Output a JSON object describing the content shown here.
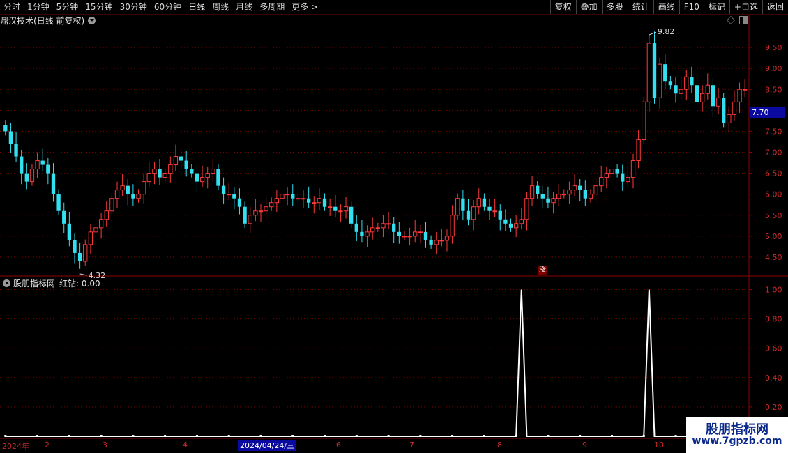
{
  "toolbar": {
    "periods": [
      "分时",
      "1分钟",
      "5分钟",
      "15分钟",
      "30分钟",
      "60分钟",
      "日线",
      "周线",
      "月线",
      "多周期",
      "更多 >"
    ],
    "active_period": "日线",
    "buttons": [
      "复权",
      "叠加",
      "多股",
      "统计",
      "画线",
      "F10",
      "标记",
      "+自选",
      "返回"
    ]
  },
  "price_panel": {
    "title": "鼎汉技术(日线 前复权)",
    "high_marker": "9.82",
    "low_marker": "4.32",
    "current_price": "7.70",
    "limit_up_marker": "涨"
  },
  "indicator_panel": {
    "title": "股朋指标网",
    "value_label": "红钻: 0.00"
  },
  "date_axis": {
    "labels": [
      "2024年",
      "2",
      "3",
      "4",
      "2024/04/24/三",
      "6",
      "7",
      "8",
      "9",
      "10"
    ]
  },
  "watermark": {
    "title": "股朋指标网",
    "url": "www.7gpzb.com"
  },
  "colors": {
    "up": "#ff3a3a",
    "down": "#33e0f0",
    "grid": "#7a0000",
    "axis_text": "#cc2a2a",
    "indicator_line": "#ffffff"
  },
  "chart_data": [
    {
      "type": "candlestick",
      "title": "鼎汉技术(日线 前复权)",
      "y_ticks": [
        4.5,
        5.0,
        5.5,
        6.0,
        6.5,
        7.0,
        7.5,
        8.0,
        8.5,
        9.0,
        9.5
      ],
      "ylim": [
        4.1,
        10.0
      ],
      "grid": true,
      "series": [
        {
          "name": "close",
          "values": [
            7.5,
            7.2,
            6.9,
            6.5,
            6.3,
            6.6,
            6.8,
            6.7,
            6.5,
            6.0,
            5.6,
            5.3,
            4.9,
            4.6,
            4.4,
            4.8,
            5.1,
            5.2,
            5.4,
            5.6,
            5.9,
            6.1,
            6.2,
            6.0,
            5.9,
            6.0,
            6.3,
            6.5,
            6.6,
            6.4,
            6.5,
            6.7,
            6.9,
            6.8,
            6.6,
            6.5,
            6.3,
            6.4,
            6.5,
            6.6,
            6.2,
            6.0,
            6.0,
            5.9,
            5.7,
            5.3,
            5.5,
            5.6,
            5.6,
            5.7,
            5.8,
            5.9,
            6.0,
            6.0,
            5.9,
            5.9,
            5.9,
            5.8,
            5.8,
            5.9,
            5.7,
            5.7,
            5.6,
            5.6,
            5.7,
            5.3,
            5.1,
            5.0,
            5.1,
            5.2,
            5.2,
            5.3,
            5.3,
            5.1,
            5.0,
            5.0,
            5.0,
            5.1,
            5.1,
            4.9,
            4.8,
            4.9,
            4.9,
            5.0,
            5.5,
            5.9,
            5.6,
            5.4,
            5.7,
            5.9,
            5.7,
            5.6,
            5.6,
            5.4,
            5.3,
            5.2,
            5.3,
            5.4,
            5.9,
            6.2,
            6.0,
            5.9,
            5.8,
            5.9,
            6.0,
            6.0,
            6.1,
            6.2,
            6.1,
            5.9,
            6.0,
            6.2,
            6.4,
            6.5,
            6.6,
            6.5,
            6.3,
            6.4,
            6.8,
            7.3,
            8.2,
            9.6,
            8.3,
            9.1,
            8.7,
            8.6,
            8.4,
            8.5,
            8.8,
            8.6,
            8.2,
            8.4,
            8.6,
            8.1,
            8.3,
            7.7,
            7.9,
            8.2,
            8.5,
            8.5
          ]
        },
        {
          "name": "indicator_红钻",
          "values": [
            0,
            0,
            0,
            0,
            0,
            0,
            0,
            0,
            0,
            0,
            0,
            0,
            0,
            0,
            0,
            0,
            0,
            0,
            0,
            0,
            0,
            0,
            0,
            0,
            0,
            0,
            0,
            0,
            0,
            0,
            0,
            0,
            0,
            0,
            0,
            0,
            0,
            0,
            0,
            0,
            0,
            0,
            0,
            0,
            0,
            0,
            0,
            0,
            0,
            0,
            0,
            0,
            0,
            0,
            0,
            0,
            0,
            0,
            0,
            0,
            0,
            0,
            0,
            0,
            0,
            0,
            0,
            0,
            0,
            0,
            0,
            0,
            0,
            0,
            0,
            0,
            0,
            0,
            0,
            0,
            0,
            0,
            0,
            0,
            0,
            0,
            0,
            0,
            0,
            0,
            0,
            0,
            0,
            0,
            0,
            0,
            0,
            1,
            0,
            0,
            0,
            0,
            0,
            0,
            0,
            0,
            0,
            0,
            0,
            0,
            0,
            0,
            0,
            0,
            0,
            0,
            0,
            0,
            0,
            0,
            0,
            1,
            0,
            0,
            0,
            0,
            0,
            0,
            0,
            0,
            0,
            0,
            0,
            0,
            0,
            0,
            0,
            0
          ]
        }
      ]
    },
    {
      "type": "line",
      "title": "股朋指标网",
      "y_ticks": [
        0.2,
        0.4,
        0.6,
        0.8,
        1.0
      ],
      "ylim": [
        0,
        1.05
      ],
      "grid": true,
      "peaks_at_x_labels": [
        "8",
        "10"
      ]
    }
  ]
}
